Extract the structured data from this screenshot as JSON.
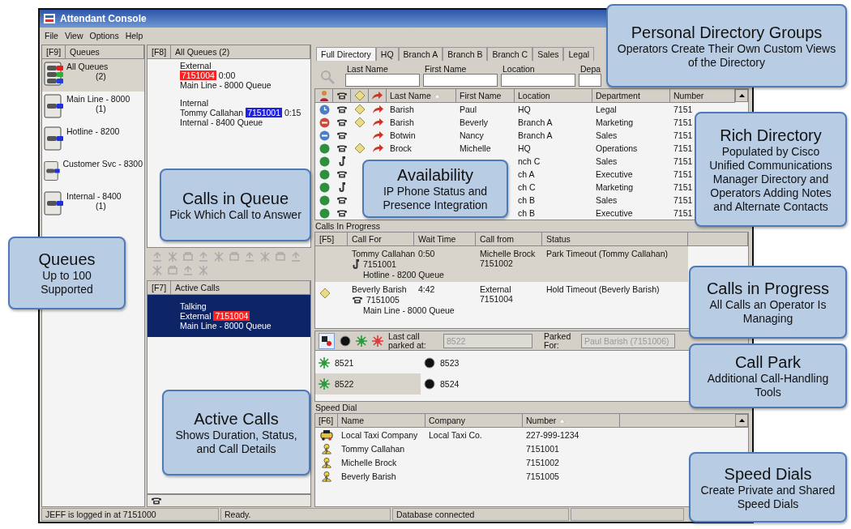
{
  "window": {
    "title": "Attendant Console"
  },
  "menu": [
    "File",
    "View",
    "Options",
    "Help"
  ],
  "queues": {
    "key": "[F9]",
    "title": "Queues",
    "items": [
      {
        "label": "All Queues",
        "count": "(2)",
        "kind": "all",
        "selected": true
      },
      {
        "label": "Main Line - 8000",
        "count": "(1)",
        "kind": "single",
        "selected": false
      },
      {
        "label": "Hotline - 8200",
        "kind": "single",
        "selected": false
      },
      {
        "label": "Customer Svc - 8300",
        "kind": "single",
        "selected": false
      },
      {
        "label": "Internal - 8400",
        "count": "(1)",
        "kind": "single",
        "selected": false
      }
    ]
  },
  "queued_calls": {
    "key": "[F8]",
    "title": "All Queues (2)",
    "calls": [
      {
        "origin": "External",
        "number": "7151004",
        "color": "#ff2020",
        "time": "0:00",
        "queue": "Main Line - 8000 Queue"
      },
      {
        "origin": "Internal",
        "caller": "Tommy Callahan",
        "number": "7151001",
        "color": "#2020e0",
        "time": "0:15",
        "queue": "Internal - 8400 Queue"
      }
    ]
  },
  "active_calls": {
    "key": "[F7]",
    "title": "Active Calls",
    "calls": [
      {
        "state": "Talking",
        "origin": "External",
        "number": "7151004",
        "color": "#ff2020",
        "queue": "Main Line - 8000 Queue",
        "selected": true
      }
    ]
  },
  "directory": {
    "tabs": [
      {
        "label": "Full Directory",
        "selected": true
      },
      {
        "label": "HQ",
        "selected": false
      },
      {
        "label": "Branch A",
        "selected": false
      },
      {
        "label": "Branch B",
        "selected": false
      },
      {
        "label": "Branch C",
        "selected": false
      },
      {
        "label": "Sales",
        "selected": false
      },
      {
        "label": "Legal",
        "selected": false
      }
    ],
    "search_fields": [
      {
        "label": "Last Name"
      },
      {
        "label": "First Name"
      },
      {
        "label": "Location"
      },
      {
        "label": "Depa"
      }
    ],
    "columns": [
      {
        "label": "Last Name",
        "sorted": true
      },
      {
        "label": "First Name",
        "sorted": false
      },
      {
        "label": "Location",
        "sorted": false
      },
      {
        "label": "Department",
        "sorted": false
      },
      {
        "label": "Number",
        "sorted": false
      }
    ],
    "rows": [
      {
        "color": "#4a7fc8",
        "away": true,
        "dnd": false,
        "off_hook": false,
        "note": true,
        "forward": true,
        "last_name": "Barish",
        "first_name": "Paul",
        "location": "HQ",
        "department": "Legal",
        "number": "7151"
      },
      {
        "color": "#c84a3a",
        "away": false,
        "dnd": true,
        "off_hook": false,
        "note": true,
        "forward": true,
        "last_name": "Barish",
        "first_name": "Beverly",
        "location": "Branch A",
        "department": "Marketing",
        "number": "7151"
      },
      {
        "color": "#4a7fc8",
        "away": false,
        "dnd": true,
        "off_hook": false,
        "note": false,
        "forward": true,
        "last_name": "Botwin",
        "first_name": "Nancy",
        "location": "Branch A",
        "department": "Sales",
        "number": "7151"
      },
      {
        "color": "#2f8f3a",
        "away": false,
        "dnd": false,
        "off_hook": false,
        "note": true,
        "forward": true,
        "last_name": "Brock",
        "first_name": "Michelle",
        "location": "HQ",
        "department": "Operations",
        "number": "7151"
      },
      {
        "color": "#2f8f3a",
        "away": false,
        "dnd": false,
        "off_hook": true,
        "location": "nch C",
        "department": "Sales",
        "number": "7151"
      },
      {
        "color": "#2f8f3a",
        "away": false,
        "dnd": false,
        "off_hook": false,
        "location": "ch A",
        "department": "Executive",
        "number": "7151"
      },
      {
        "color": "#2f8f3a",
        "away": false,
        "dnd": false,
        "off_hook": true,
        "location": "ch C",
        "department": "Marketing",
        "number": "7151"
      },
      {
        "color": "#2f8f3a",
        "away": false,
        "dnd": false,
        "off_hook": false,
        "location": "ch B",
        "department": "Sales",
        "number": "7151"
      },
      {
        "color": "#2f8f3a",
        "away": false,
        "dnd": false,
        "off_hook": false,
        "location": "ch B",
        "department": "Executive",
        "number": "7151"
      }
    ]
  },
  "calls_in_progress": {
    "title": "Calls In Progress",
    "key": "[F5]",
    "columns": [
      "Call For",
      "Wait Time",
      "Call from",
      "Status"
    ],
    "rows": [
      {
        "selected": true,
        "note": false,
        "off_hook": true,
        "call_for": "Tommy Callahan",
        "number": "7151001",
        "queue": "Hotline - 8200 Queue",
        "wait": "0:50",
        "from": "Michelle Brock",
        "from_number": "7151002",
        "status": "Park Timeout (Tommy Callahan)"
      },
      {
        "selected": false,
        "note": true,
        "off_hook": false,
        "call_for": "Beverly Barish",
        "number": "7151005",
        "queue": "Main Line - 8000 Queue",
        "wait": "4:42",
        "from": "External",
        "from_number": "7151004",
        "status": "Hold Timeout (Beverly Barish)"
      }
    ]
  },
  "call_park": {
    "last_label": "Last call parked at:",
    "last_value": "8522",
    "for_label": "Parked For:",
    "for_value": "Paul Barish (7151006)",
    "slots": [
      {
        "number": "8521",
        "occupied": true,
        "selected": false
      },
      {
        "number": "8523",
        "occupied": false,
        "selected": false
      },
      {
        "number": "8522",
        "occupied": true,
        "selected": true
      },
      {
        "number": "8524",
        "occupied": false,
        "selected": false
      }
    ]
  },
  "speed_dial": {
    "title": "Speed Dial",
    "key": "[F6]",
    "columns": [
      {
        "label": "Name",
        "sorted": false
      },
      {
        "label": "Company",
        "sorted": false
      },
      {
        "label": "Number",
        "sorted": true
      }
    ],
    "rows": [
      {
        "kind": "company",
        "name": "Local Taxi Company",
        "company": "Local Taxi Co.",
        "number": "227-999-1234"
      },
      {
        "kind": "person",
        "name": "Tommy Callahan",
        "number": "7151001"
      },
      {
        "kind": "person",
        "name": "Michelle Brock",
        "number": "7151002"
      },
      {
        "kind": "person",
        "name": "Beverly Barish",
        "number": "7151005"
      }
    ]
  },
  "status_bar": [
    "JEFF is logged in at 7151000",
    "Ready.",
    "Database connected"
  ],
  "callouts": [
    {
      "title": "Personal Directory Groups",
      "text": "Operators Create Their Own Custom Views of the Directory"
    },
    {
      "title": "Rich Directory",
      "text": "Populated by Cisco Unified Communications Manager Directory and Operators Adding Notes and Alternate Contacts"
    },
    {
      "title": "Calls in Queue",
      "text": "Pick Which Call to Answer"
    },
    {
      "title": "Availability",
      "text": "IP Phone Status and Presence Integration"
    },
    {
      "title": "Queues",
      "text": "Up to 100 Supported"
    },
    {
      "title": "Calls in Progress",
      "text": "All Calls an Operator Is Managing"
    },
    {
      "title": "Call Park",
      "text": "Additional Call-Handling Tools"
    },
    {
      "title": "Active Calls",
      "text": "Shows Duration, Status, and Call Details"
    },
    {
      "title": "Speed Dials",
      "text": "Create Private and Shared Speed Dials"
    }
  ]
}
